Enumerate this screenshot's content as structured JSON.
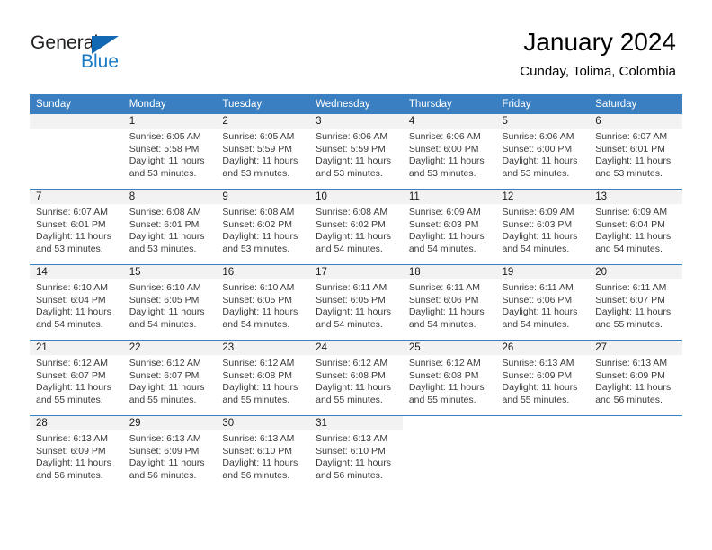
{
  "brand": {
    "name_part1": "General",
    "name_part2": "Blue",
    "triangle_icon": "triangle-icon",
    "accent_color": "#1a7ac4",
    "logo_dark_color": "#231f20"
  },
  "header": {
    "title": "January 2024",
    "subtitle": "Cunday, Tolima, Colombia"
  },
  "calendar": {
    "header_bg_color": "#3a7fc1",
    "daynum_bg_color": "#f2f2f2",
    "weekdays": [
      "Sunday",
      "Monday",
      "Tuesday",
      "Wednesday",
      "Thursday",
      "Friday",
      "Saturday"
    ],
    "weeks": [
      [
        {
          "day": "",
          "lines": [
            "",
            "",
            "",
            ""
          ],
          "empty": true
        },
        {
          "day": "1",
          "lines": [
            "Sunrise: 6:05 AM",
            "Sunset: 5:58 PM",
            "Daylight: 11 hours",
            "and 53 minutes."
          ]
        },
        {
          "day": "2",
          "lines": [
            "Sunrise: 6:05 AM",
            "Sunset: 5:59 PM",
            "Daylight: 11 hours",
            "and 53 minutes."
          ]
        },
        {
          "day": "3",
          "lines": [
            "Sunrise: 6:06 AM",
            "Sunset: 5:59 PM",
            "Daylight: 11 hours",
            "and 53 minutes."
          ]
        },
        {
          "day": "4",
          "lines": [
            "Sunrise: 6:06 AM",
            "Sunset: 6:00 PM",
            "Daylight: 11 hours",
            "and 53 minutes."
          ]
        },
        {
          "day": "5",
          "lines": [
            "Sunrise: 6:06 AM",
            "Sunset: 6:00 PM",
            "Daylight: 11 hours",
            "and 53 minutes."
          ]
        },
        {
          "day": "6",
          "lines": [
            "Sunrise: 6:07 AM",
            "Sunset: 6:01 PM",
            "Daylight: 11 hours",
            "and 53 minutes."
          ]
        }
      ],
      [
        {
          "day": "7",
          "lines": [
            "Sunrise: 6:07 AM",
            "Sunset: 6:01 PM",
            "Daylight: 11 hours",
            "and 53 minutes."
          ]
        },
        {
          "day": "8",
          "lines": [
            "Sunrise: 6:08 AM",
            "Sunset: 6:01 PM",
            "Daylight: 11 hours",
            "and 53 minutes."
          ]
        },
        {
          "day": "9",
          "lines": [
            "Sunrise: 6:08 AM",
            "Sunset: 6:02 PM",
            "Daylight: 11 hours",
            "and 53 minutes."
          ]
        },
        {
          "day": "10",
          "lines": [
            "Sunrise: 6:08 AM",
            "Sunset: 6:02 PM",
            "Daylight: 11 hours",
            "and 54 minutes."
          ]
        },
        {
          "day": "11",
          "lines": [
            "Sunrise: 6:09 AM",
            "Sunset: 6:03 PM",
            "Daylight: 11 hours",
            "and 54 minutes."
          ]
        },
        {
          "day": "12",
          "lines": [
            "Sunrise: 6:09 AM",
            "Sunset: 6:03 PM",
            "Daylight: 11 hours",
            "and 54 minutes."
          ]
        },
        {
          "day": "13",
          "lines": [
            "Sunrise: 6:09 AM",
            "Sunset: 6:04 PM",
            "Daylight: 11 hours",
            "and 54 minutes."
          ]
        }
      ],
      [
        {
          "day": "14",
          "lines": [
            "Sunrise: 6:10 AM",
            "Sunset: 6:04 PM",
            "Daylight: 11 hours",
            "and 54 minutes."
          ]
        },
        {
          "day": "15",
          "lines": [
            "Sunrise: 6:10 AM",
            "Sunset: 6:05 PM",
            "Daylight: 11 hours",
            "and 54 minutes."
          ]
        },
        {
          "day": "16",
          "lines": [
            "Sunrise: 6:10 AM",
            "Sunset: 6:05 PM",
            "Daylight: 11 hours",
            "and 54 minutes."
          ]
        },
        {
          "day": "17",
          "lines": [
            "Sunrise: 6:11 AM",
            "Sunset: 6:05 PM",
            "Daylight: 11 hours",
            "and 54 minutes."
          ]
        },
        {
          "day": "18",
          "lines": [
            "Sunrise: 6:11 AM",
            "Sunset: 6:06 PM",
            "Daylight: 11 hours",
            "and 54 minutes."
          ]
        },
        {
          "day": "19",
          "lines": [
            "Sunrise: 6:11 AM",
            "Sunset: 6:06 PM",
            "Daylight: 11 hours",
            "and 54 minutes."
          ]
        },
        {
          "day": "20",
          "lines": [
            "Sunrise: 6:11 AM",
            "Sunset: 6:07 PM",
            "Daylight: 11 hours",
            "and 55 minutes."
          ]
        }
      ],
      [
        {
          "day": "21",
          "lines": [
            "Sunrise: 6:12 AM",
            "Sunset: 6:07 PM",
            "Daylight: 11 hours",
            "and 55 minutes."
          ]
        },
        {
          "day": "22",
          "lines": [
            "Sunrise: 6:12 AM",
            "Sunset: 6:07 PM",
            "Daylight: 11 hours",
            "and 55 minutes."
          ]
        },
        {
          "day": "23",
          "lines": [
            "Sunrise: 6:12 AM",
            "Sunset: 6:08 PM",
            "Daylight: 11 hours",
            "and 55 minutes."
          ]
        },
        {
          "day": "24",
          "lines": [
            "Sunrise: 6:12 AM",
            "Sunset: 6:08 PM",
            "Daylight: 11 hours",
            "and 55 minutes."
          ]
        },
        {
          "day": "25",
          "lines": [
            "Sunrise: 6:12 AM",
            "Sunset: 6:08 PM",
            "Daylight: 11 hours",
            "and 55 minutes."
          ]
        },
        {
          "day": "26",
          "lines": [
            "Sunrise: 6:13 AM",
            "Sunset: 6:09 PM",
            "Daylight: 11 hours",
            "and 55 minutes."
          ]
        },
        {
          "day": "27",
          "lines": [
            "Sunrise: 6:13 AM",
            "Sunset: 6:09 PM",
            "Daylight: 11 hours",
            "and 56 minutes."
          ]
        }
      ],
      [
        {
          "day": "28",
          "lines": [
            "Sunrise: 6:13 AM",
            "Sunset: 6:09 PM",
            "Daylight: 11 hours",
            "and 56 minutes."
          ]
        },
        {
          "day": "29",
          "lines": [
            "Sunrise: 6:13 AM",
            "Sunset: 6:09 PM",
            "Daylight: 11 hours",
            "and 56 minutes."
          ]
        },
        {
          "day": "30",
          "lines": [
            "Sunrise: 6:13 AM",
            "Sunset: 6:10 PM",
            "Daylight: 11 hours",
            "and 56 minutes."
          ]
        },
        {
          "day": "31",
          "lines": [
            "Sunrise: 6:13 AM",
            "Sunset: 6:10 PM",
            "Daylight: 11 hours",
            "and 56 minutes."
          ]
        },
        {
          "day": "",
          "lines": [
            "",
            "",
            "",
            ""
          ],
          "blank": true
        },
        {
          "day": "",
          "lines": [
            "",
            "",
            "",
            ""
          ],
          "blank": true
        },
        {
          "day": "",
          "lines": [
            "",
            "",
            "",
            ""
          ],
          "blank": true
        }
      ]
    ]
  }
}
